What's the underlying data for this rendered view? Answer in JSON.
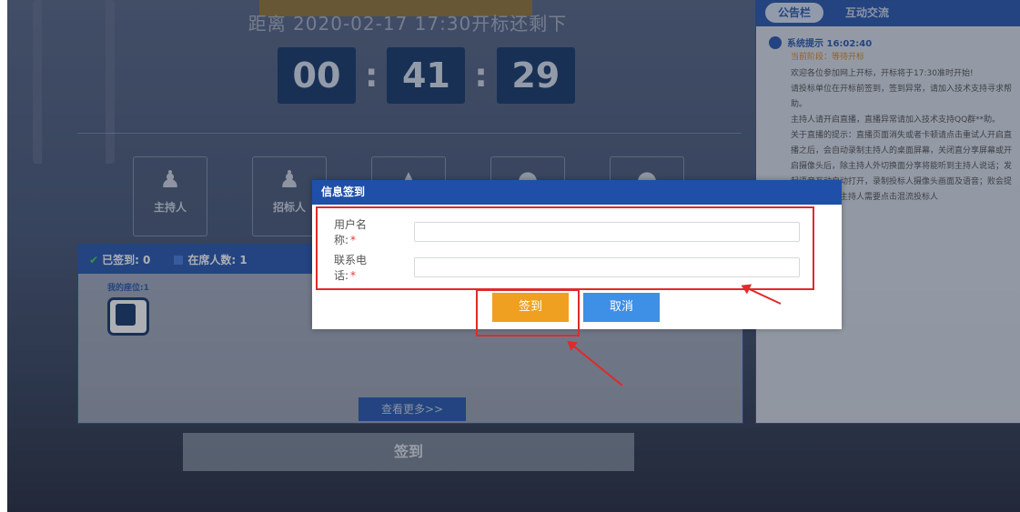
{
  "header": {
    "banner": "",
    "countdown_text": "距离 2020-02-17 17:30开标还剩下",
    "timer": [
      "00",
      "41",
      "29"
    ],
    "separator": ":"
  },
  "roles": [
    {
      "label": "主持人",
      "icon": "host-icon"
    },
    {
      "label": "招标人",
      "icon": "tenderer-icon"
    },
    {
      "label": "",
      "icon": "agent-icon"
    },
    {
      "label": "",
      "icon": "bidder-icon"
    },
    {
      "label": "",
      "icon": "user-icon"
    }
  ],
  "stats": {
    "signed": "已签到: 0",
    "present": "在席人数: 1",
    "seat_label": "我的座位:1",
    "more_button": "查看更多>>",
    "colors": {
      "accent": "#2b5bb0",
      "ok": "#52d052"
    }
  },
  "bottom": {
    "signin_button": "签到"
  },
  "right_panel": {
    "tabs": [
      "公告栏",
      "互动交流"
    ],
    "message_title": "系统提示 16:02:40",
    "stage": "当前阶段：等待开标",
    "messages": [
      "欢迎各位参加网上开标，开标将于17:30准时开始!",
      "请投标单位在开标前签到，签到异常，请加入技术支持寻求帮助。",
      "主持人请开启直播，直播异常请加入技术支持QQ群**助。",
      "关于直播的提示：直播页面消失或者卡顿请点击重试人开启直播之后，会自动录制主持人的桌面屏幕，关闭直分享屏幕或开启摄像头后，除主持人外切换面分享将能听到主持人说话；发起语音互动自动打开，录制投标人摄像头画面及语音；败会提示混流失败，主持人需要点击混流投标人"
    ]
  },
  "dialog": {
    "title": "信息签到",
    "fields": [
      {
        "label": "用户名称:",
        "required": "*",
        "value": "",
        "placeholder": ""
      },
      {
        "label": "联系电话:",
        "required": "*",
        "value": "",
        "placeholder": ""
      }
    ],
    "confirm_button": "签到",
    "cancel_button": "取消",
    "colors": {
      "title_bar": "#1f4fa8",
      "confirm": "#f0a020",
      "cancel": "#3e8fe6",
      "highlight": "#e02a2a"
    }
  }
}
